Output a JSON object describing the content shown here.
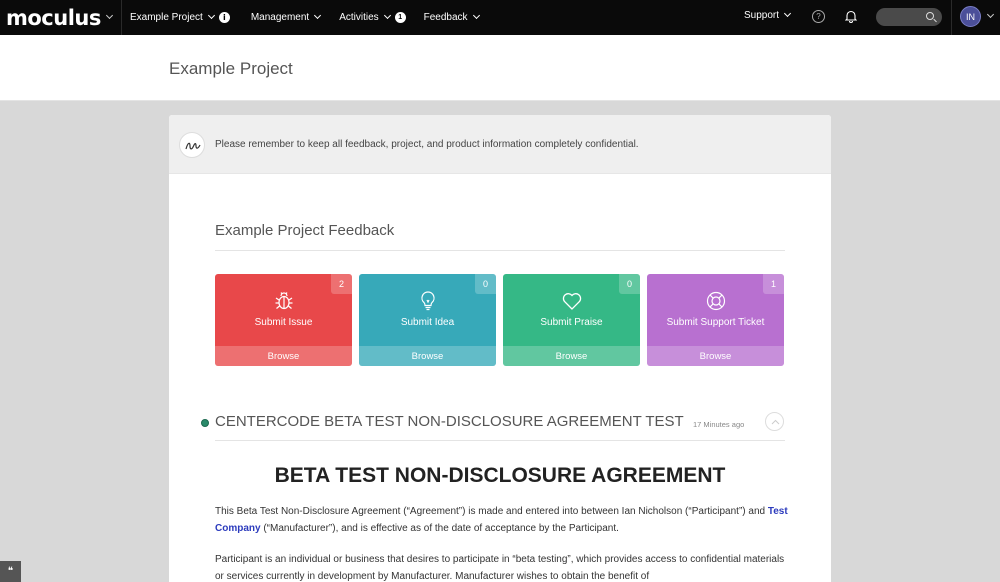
{
  "nav": {
    "brand": "moculus",
    "project_menu": "Example Project",
    "management": "Management",
    "activities": "Activities",
    "activities_badge": "1",
    "feedback": "Feedback",
    "support": "Support",
    "avatar_initials": "IN"
  },
  "header": {
    "title": "Example Project"
  },
  "notice": {
    "text": "Please remember to keep all feedback, project, and product information completely confidential."
  },
  "feedback": {
    "title": "Example Project Feedback",
    "tiles": [
      {
        "label": "Submit Issue",
        "count": "2",
        "browse": "Browse",
        "color": "#e8484a",
        "icon": "bug-icon"
      },
      {
        "label": "Submit Idea",
        "count": "0",
        "browse": "Browse",
        "color": "#37a9b9",
        "icon": "lightbulb-icon"
      },
      {
        "label": "Submit Praise",
        "count": "0",
        "browse": "Browse",
        "color": "#35b886",
        "icon": "heart-icon"
      },
      {
        "label": "Submit Support Ticket",
        "count": "1",
        "browse": "Browse",
        "color": "#b870d0",
        "icon": "lifebuoy-icon"
      }
    ]
  },
  "activity": {
    "title": "CENTERCODE BETA TEST NON-DISCLOSURE AGREEMENT TEST",
    "time": "17 Minutes ago",
    "doc_heading": "BETA TEST NON-DISCLOSURE AGREEMENT",
    "p1_a": "This Beta Test Non-Disclosure Agreement (“Agreement”) is made and entered into between Ian Nicholson (“Participant”) and ",
    "p1_link": "Test Company",
    "p1_b": " (“Manufacturer”), and is effective as of the date of acceptance by the Participant.",
    "p2": "Participant is an individual or business that desires to participate in “beta testing”, which provides access to confidential materials or services currently in development by Manufacturer. Manufacturer wishes to obtain the benefit of"
  }
}
